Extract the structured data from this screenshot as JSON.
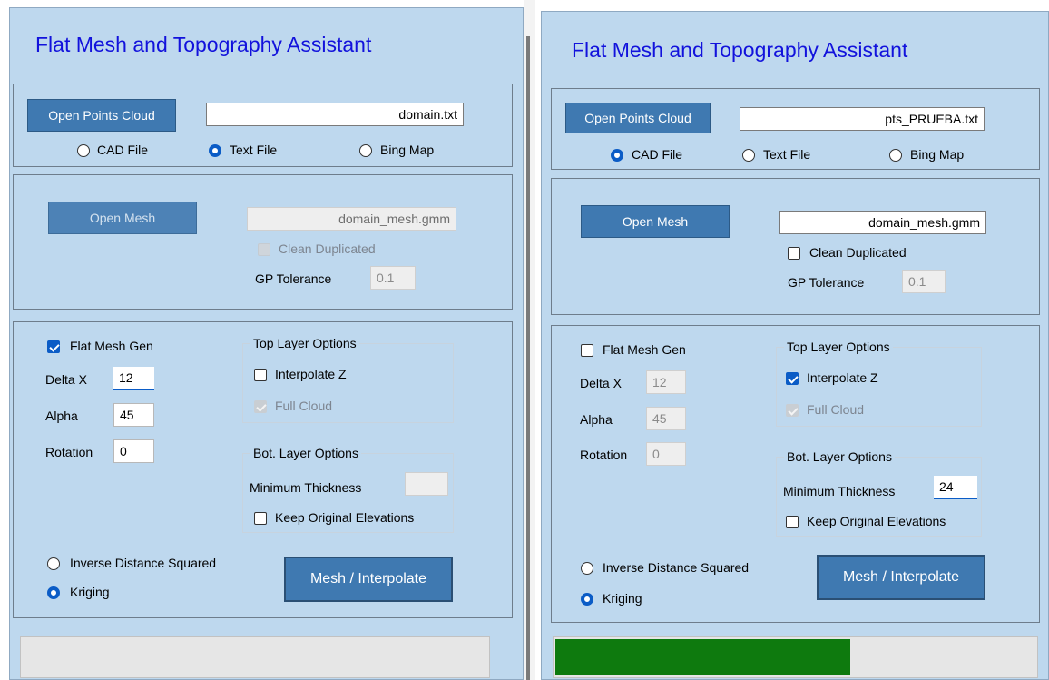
{
  "colors": {
    "panel_bg": "#bed8ee",
    "title": "#1212dc",
    "button": "#3f79b1",
    "progress_fill": "#0e7a0e",
    "accent": "#0b5cc6"
  },
  "left": {
    "title": "Flat Mesh and Topography Assistant",
    "points_cloud": {
      "button_label": "Open Points Cloud",
      "file_value": "domain.txt",
      "sources": [
        {
          "label": "CAD File",
          "selected": false
        },
        {
          "label": "Text File",
          "selected": true
        },
        {
          "label": "Bing Map",
          "selected": false
        }
      ]
    },
    "mesh": {
      "button_label": "Open Mesh",
      "file_value": "domain_mesh.gmm",
      "clean_duplicated_label": "Clean Duplicated",
      "gp_tolerance_label": "GP Tolerance",
      "gp_tolerance_value": "0.1"
    },
    "flat_mesh": {
      "gen_label": "Flat Mesh Gen",
      "gen_checked": true,
      "delta_x_label": "Delta X",
      "delta_x_value": "12",
      "alpha_label": "Alpha",
      "alpha_value": "45",
      "rotation_label": "Rotation",
      "rotation_value": "0"
    },
    "top_layer": {
      "legend": "Top Layer Options",
      "interpolate_z_label": "Interpolate Z",
      "interpolate_z_checked": false,
      "full_cloud_label": "Full Cloud"
    },
    "bot_layer": {
      "legend": "Bot. Layer Options",
      "min_thickness_label": "Minimum Thickness",
      "min_thickness_value": "",
      "keep_elevations_label": "Keep Original Elevations"
    },
    "method": {
      "options": [
        {
          "label": "Inverse Distance Squared",
          "selected": false
        },
        {
          "label": "Kriging",
          "selected": true
        }
      ]
    },
    "run_button_label": "Mesh / Interpolate",
    "progress": 0
  },
  "right": {
    "title": "Flat Mesh and Topography Assistant",
    "points_cloud": {
      "button_label": "Open Points Cloud",
      "file_value": "pts_PRUEBA.txt",
      "sources": [
        {
          "label": "CAD File",
          "selected": true
        },
        {
          "label": "Text File",
          "selected": false
        },
        {
          "label": "Bing Map",
          "selected": false
        }
      ]
    },
    "mesh": {
      "button_label": "Open Mesh",
      "file_value": "domain_mesh.gmm",
      "clean_duplicated_label": "Clean Duplicated",
      "gp_tolerance_label": "GP Tolerance",
      "gp_tolerance_value": "0.1"
    },
    "flat_mesh": {
      "gen_label": "Flat Mesh Gen",
      "gen_checked": false,
      "delta_x_label": "Delta X",
      "delta_x_value": "12",
      "alpha_label": "Alpha",
      "alpha_value": "45",
      "rotation_label": "Rotation",
      "rotation_value": "0"
    },
    "top_layer": {
      "legend": "Top Layer Options",
      "interpolate_z_label": "Interpolate Z",
      "interpolate_z_checked": true,
      "full_cloud_label": "Full Cloud"
    },
    "bot_layer": {
      "legend": "Bot. Layer Options",
      "min_thickness_label": "Minimum Thickness",
      "min_thickness_value": "24",
      "keep_elevations_label": "Keep Original Elevations"
    },
    "method": {
      "options": [
        {
          "label": "Inverse Distance Squared",
          "selected": false
        },
        {
          "label": "Kriging",
          "selected": true
        }
      ]
    },
    "run_button_label": "Mesh / Interpolate",
    "progress": 0.61
  }
}
